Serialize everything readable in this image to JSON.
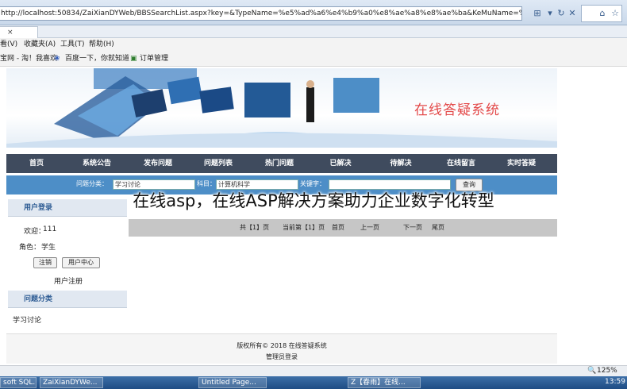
{
  "browser": {
    "url": "http://localhost:50834/ZaiXianDYWeb/BBSSearchList.aspx?key=&TypeName=%e5%ad%a6%e4%b9%a0%e8%ae%a8%e8%ae%ba&KeMuName=%e8%ae%a1%e7%ae%",
    "tab_label": "",
    "menu": [
      "看(V)",
      "收藏夹(A)",
      "工具(T)",
      "帮助(H)"
    ],
    "favorites": [
      "宝网 - 淘！我喜欢",
      "百度一下，你就知道",
      "订单管理"
    ]
  },
  "banner": {
    "title": "在线答疑系统"
  },
  "nav": {
    "items": [
      "首页",
      "系统公告",
      "发布问题",
      "问题列表",
      "热门问题",
      "已解决",
      "待解决",
      "在线留言",
      "实时答疑"
    ]
  },
  "search": {
    "type_label": "问题分类：",
    "type_value": "学习讨论",
    "subject_label": "科目：",
    "subject_value": "计算机科学",
    "keyword_label": "关键字：",
    "keyword_value": "",
    "button": "查询"
  },
  "overlay": "在线asp，在线ASP解决方案助力企业数字化转型",
  "sidebar": {
    "login_title": "用户登录",
    "welcome_label": "欢迎：",
    "welcome_value": "111",
    "role_label": "角色：",
    "role_value": "学生",
    "logout_button": "注销",
    "center_button": "用户中心",
    "register_link": "用户注册",
    "category_title": "问题分类",
    "categories": [
      "学习讨论"
    ]
  },
  "pager": {
    "total": "共【1】页",
    "current": "当前第【1】页",
    "first": "首页",
    "prev": "上一页",
    "next": "下一页",
    "last": "尾页"
  },
  "footer": {
    "copyright": "版权所有© 2018 在线答疑系统",
    "admin_link": "管理员登录"
  },
  "status": {
    "zoom": "125%"
  },
  "taskbar": {
    "items": [
      "soft SQL...",
      "ZaiXianDYWe...",
      "Untitled Page...",
      "Z【春雨】在线..."
    ],
    "clock": "13:59"
  },
  "colors": {
    "nav_bg": "#3f4b5e",
    "search_bg": "#4d8ec7",
    "banner_title": "#e34a4a",
    "sidebar_head": "#2e5c94"
  }
}
